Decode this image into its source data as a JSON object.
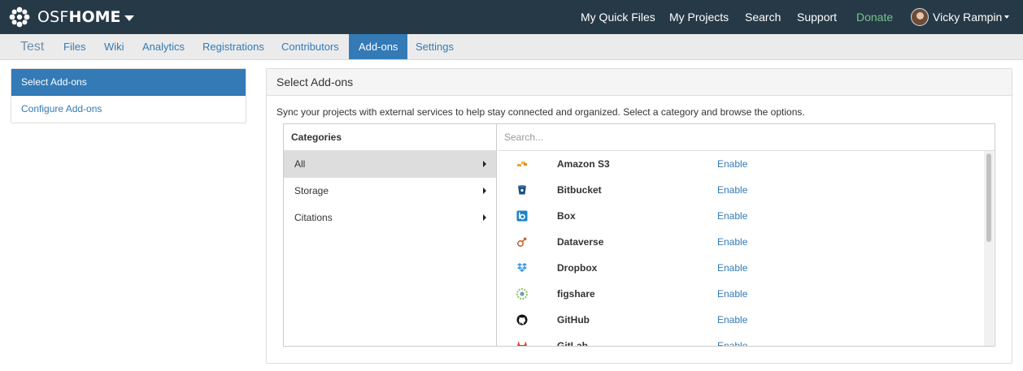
{
  "brand": {
    "osf": "OSF",
    "home": "HOME"
  },
  "topnav": {
    "quick_files": "My Quick Files",
    "projects": "My Projects",
    "search": "Search",
    "support": "Support",
    "donate": "Donate",
    "user_name": "Vicky Rampin"
  },
  "project": {
    "title": "Test",
    "tabs": [
      "Files",
      "Wiki",
      "Analytics",
      "Registrations",
      "Contributors",
      "Add-ons",
      "Settings"
    ],
    "active_tab": "Add-ons"
  },
  "sidebar": {
    "items": [
      {
        "label": "Select Add-ons",
        "active": true
      },
      {
        "label": "Configure Add-ons",
        "active": false
      }
    ]
  },
  "panel": {
    "title": "Select Add-ons",
    "intro": "Sync your projects with external services to help stay connected and organized. Select a category and browse the options.",
    "categories_header": "Categories",
    "categories": [
      {
        "label": "All",
        "active": true
      },
      {
        "label": "Storage",
        "active": false
      },
      {
        "label": "Citations",
        "active": false
      }
    ],
    "search_placeholder": "Search...",
    "addons": [
      {
        "name": "Amazon S3",
        "action": "Enable",
        "icon": "amazon-s3-icon"
      },
      {
        "name": "Bitbucket",
        "action": "Enable",
        "icon": "bitbucket-icon"
      },
      {
        "name": "Box",
        "action": "Enable",
        "icon": "box-icon"
      },
      {
        "name": "Dataverse",
        "action": "Enable",
        "icon": "dataverse-icon"
      },
      {
        "name": "Dropbox",
        "action": "Enable",
        "icon": "dropbox-icon"
      },
      {
        "name": "figshare",
        "action": "Enable",
        "icon": "figshare-icon"
      },
      {
        "name": "GitHub",
        "action": "Enable",
        "icon": "github-icon"
      },
      {
        "name": "GitLab",
        "action": "Enable",
        "icon": "gitlab-icon"
      }
    ]
  },
  "colors": {
    "navbar": "#263947",
    "accent": "#337ab7",
    "donate": "#77c58d"
  }
}
